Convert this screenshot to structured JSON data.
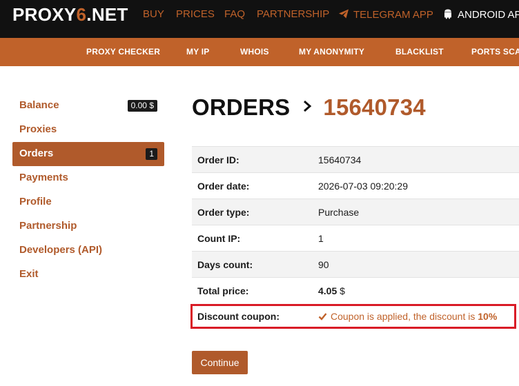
{
  "header": {
    "logo_main": "PROXY",
    "logo_accent": "6",
    "logo_tail": ".NET",
    "nav": [
      "BUY",
      "PRICES",
      "FAQ",
      "PARTNERSHIP",
      "TELEGRAM APP",
      "ANDROID APP"
    ]
  },
  "subnav": [
    "PROXY CHECKER",
    "MY IP",
    "WHOIS",
    "MY ANONYMITY",
    "BLACKLIST",
    "PORTS SCAN"
  ],
  "sidebar": {
    "items": [
      {
        "label": "Balance",
        "badge": "0.00 $"
      },
      {
        "label": "Proxies"
      },
      {
        "label": "Orders",
        "badge": "1",
        "active": true
      },
      {
        "label": "Payments"
      },
      {
        "label": "Profile"
      },
      {
        "label": "Partnership"
      },
      {
        "label": "Developers (API)"
      },
      {
        "label": "Exit"
      }
    ]
  },
  "page": {
    "title": "ORDERS",
    "order_number": "15640734"
  },
  "order": {
    "rows": [
      {
        "label": "Order ID:",
        "value": "15640734"
      },
      {
        "label": "Order date:",
        "value": "2026-07-03 09:20:29"
      },
      {
        "label": "Order type:",
        "value": "Purchase"
      },
      {
        "label": "Count IP:",
        "value": "1"
      },
      {
        "label": "Days count:",
        "value": "90"
      }
    ],
    "total_label": "Total price:",
    "total_amount": "4.05",
    "total_currency": "$",
    "coupon_label": "Discount coupon:",
    "coupon_text": "Coupon is applied, the discount is",
    "coupon_discount": "10%"
  },
  "actions": {
    "continue_label": "Continue"
  },
  "colors": {
    "accent": "#c0622a",
    "topbar": "#111111",
    "highlight": "#d91b26"
  },
  "icons": {
    "telegram": "paper-plane-icon",
    "android": "android-icon",
    "breadcrumb": "chevron-right-icon",
    "coupon": "check-icon"
  }
}
